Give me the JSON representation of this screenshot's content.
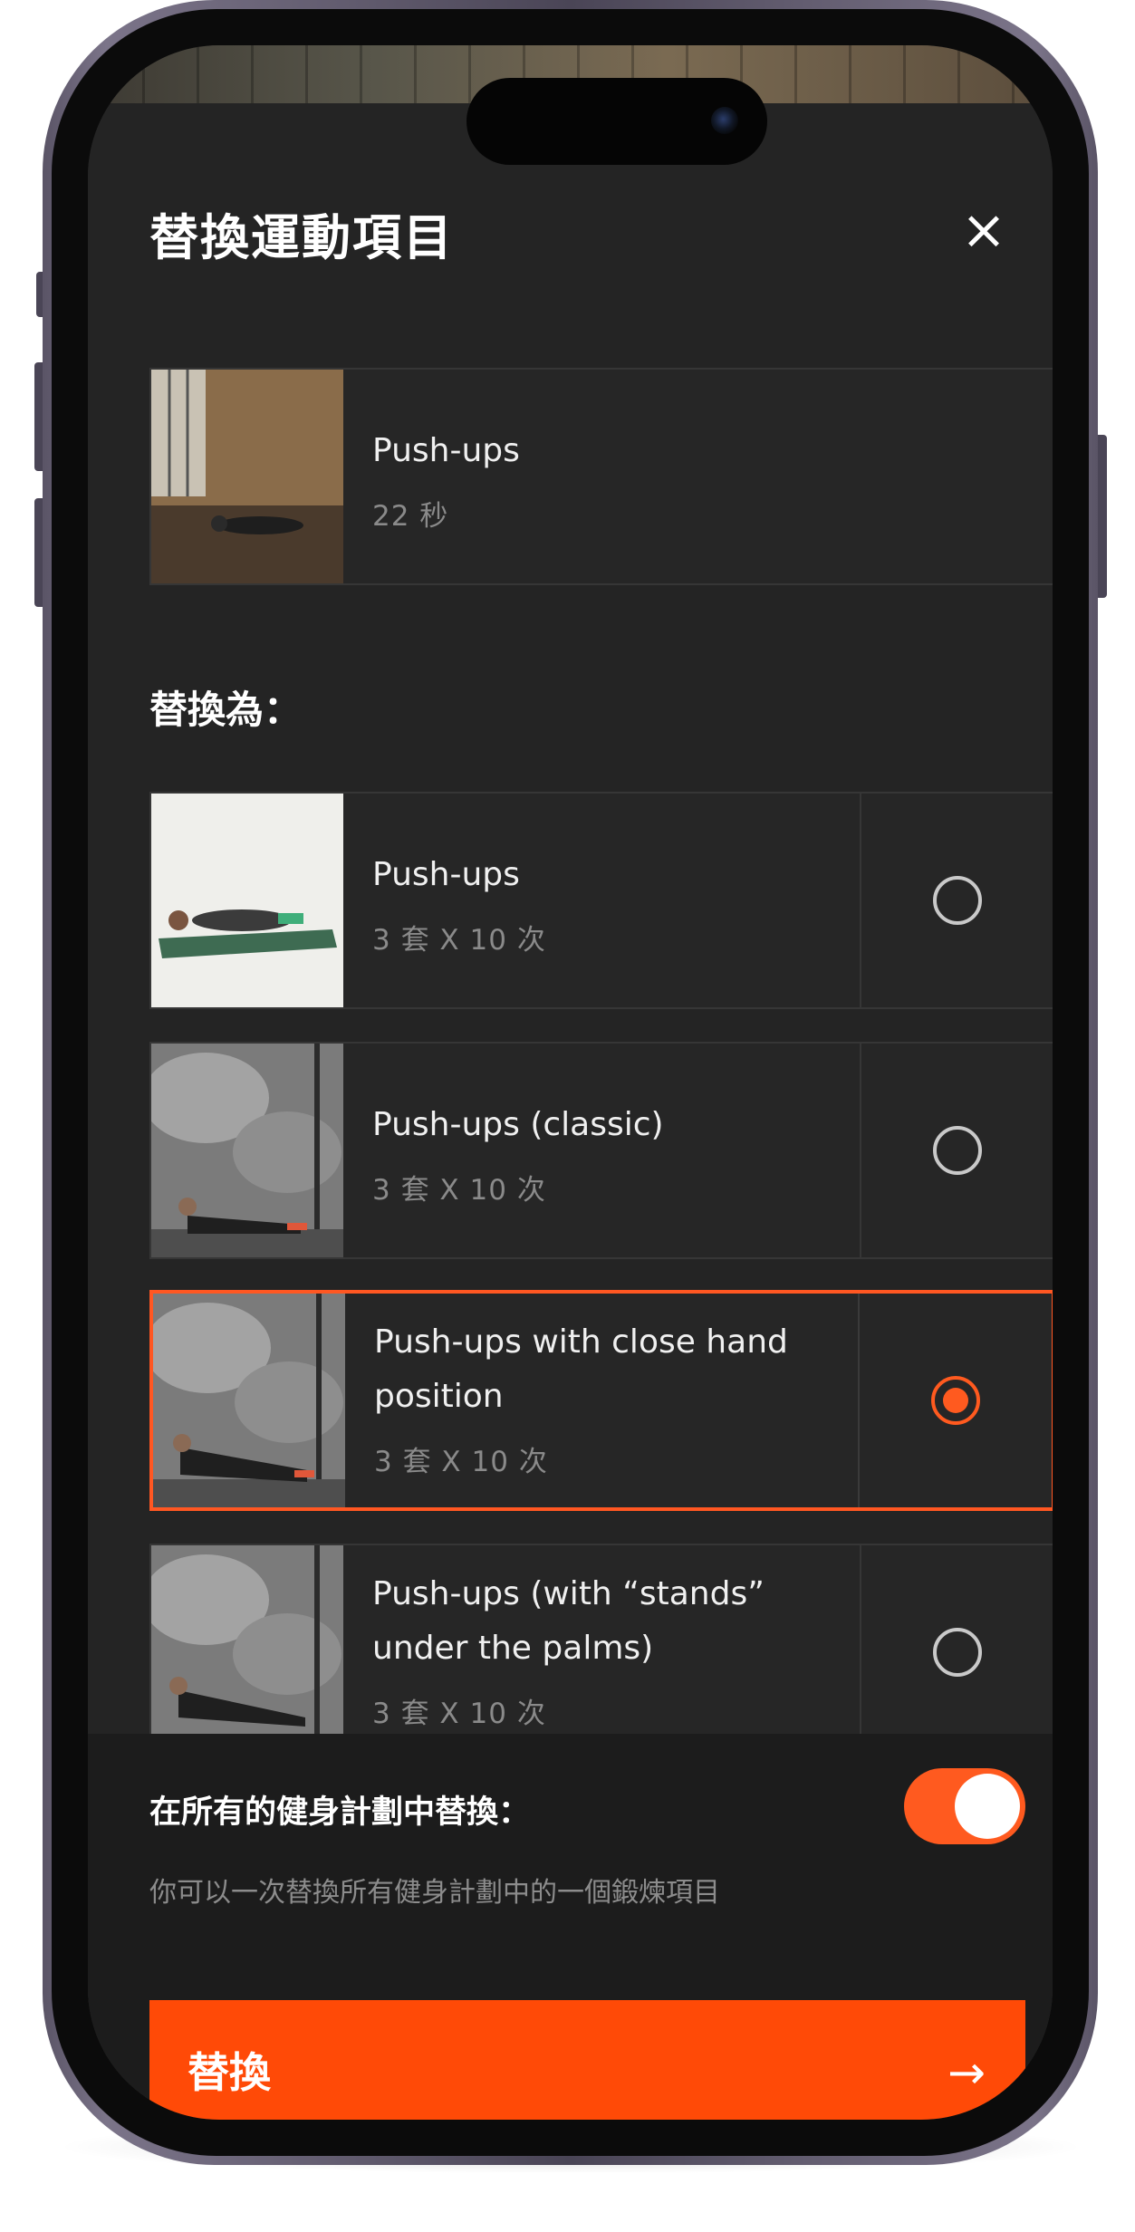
{
  "header": {
    "title": "替換運動項目",
    "close_icon": "×"
  },
  "current_exercise": {
    "name": "Push-ups",
    "duration": "22 秒"
  },
  "replace_with_label": "替換為：",
  "options": [
    {
      "name": "Push-ups",
      "detail": "3 套 X 10 次",
      "selected": false
    },
    {
      "name": "Push-ups (classic)",
      "detail": "3 套 X 10 次",
      "selected": false
    },
    {
      "name": "Push-ups with close hand position",
      "detail": "3 套 X 10 次",
      "selected": true
    },
    {
      "name": "Push-ups (with “stands” under the palms)",
      "detail": "3 套 X 10 次",
      "selected": false
    }
  ],
  "bottom": {
    "toggle_label": "在所有的健身計劃中替換：",
    "toggle_on": true,
    "toggle_description": "你可以一次替換所有健身計劃中的一個鍛煉項目",
    "cta_label": "替換",
    "cta_icon": "→"
  },
  "colors": {
    "accent": "#ff4a07",
    "background": "#242424",
    "card_border": "#363636"
  },
  "icons": [
    "close-icon",
    "radio-icon",
    "arrow-right-icon"
  ]
}
